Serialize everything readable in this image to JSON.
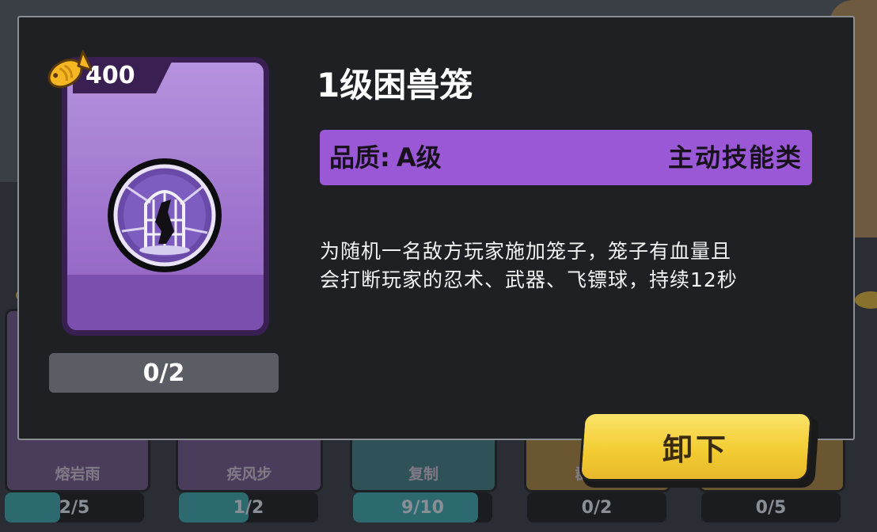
{
  "skill": {
    "price": "400",
    "title": "1级困兽笼",
    "quality_label": "品质:",
    "quality_value": "A级",
    "type": "主动技能类",
    "description_line1": "为随机一名敌方玩家施加笼子，笼子有血量且",
    "description_line2": "会打断玩家的忍术、武器、飞镖球，持续12秒",
    "owned_count": "0/2"
  },
  "actions": {
    "unequip_label": "卸下"
  },
  "background_cards": [
    {
      "name": "熔岩雨",
      "progress": "2/5",
      "fill": 0.4
    },
    {
      "name": "疾风步",
      "progress": "1/2",
      "fill": 0.5
    },
    {
      "name": "复制",
      "progress": "9/10",
      "fill": 0.9
    },
    {
      "name": "群体…",
      "progress": "0/2",
      "fill": 0
    },
    {
      "name": "",
      "progress": "0/5",
      "fill": 0
    }
  ],
  "colors": {
    "quality_bar": "#9b58d6",
    "card_purple": "#b592de",
    "button_yellow": "#f3cd33",
    "modal_bg": "#1e2024"
  },
  "icons": {
    "coin": "fish-coin-icon",
    "skill": "cage-skill-icon"
  }
}
